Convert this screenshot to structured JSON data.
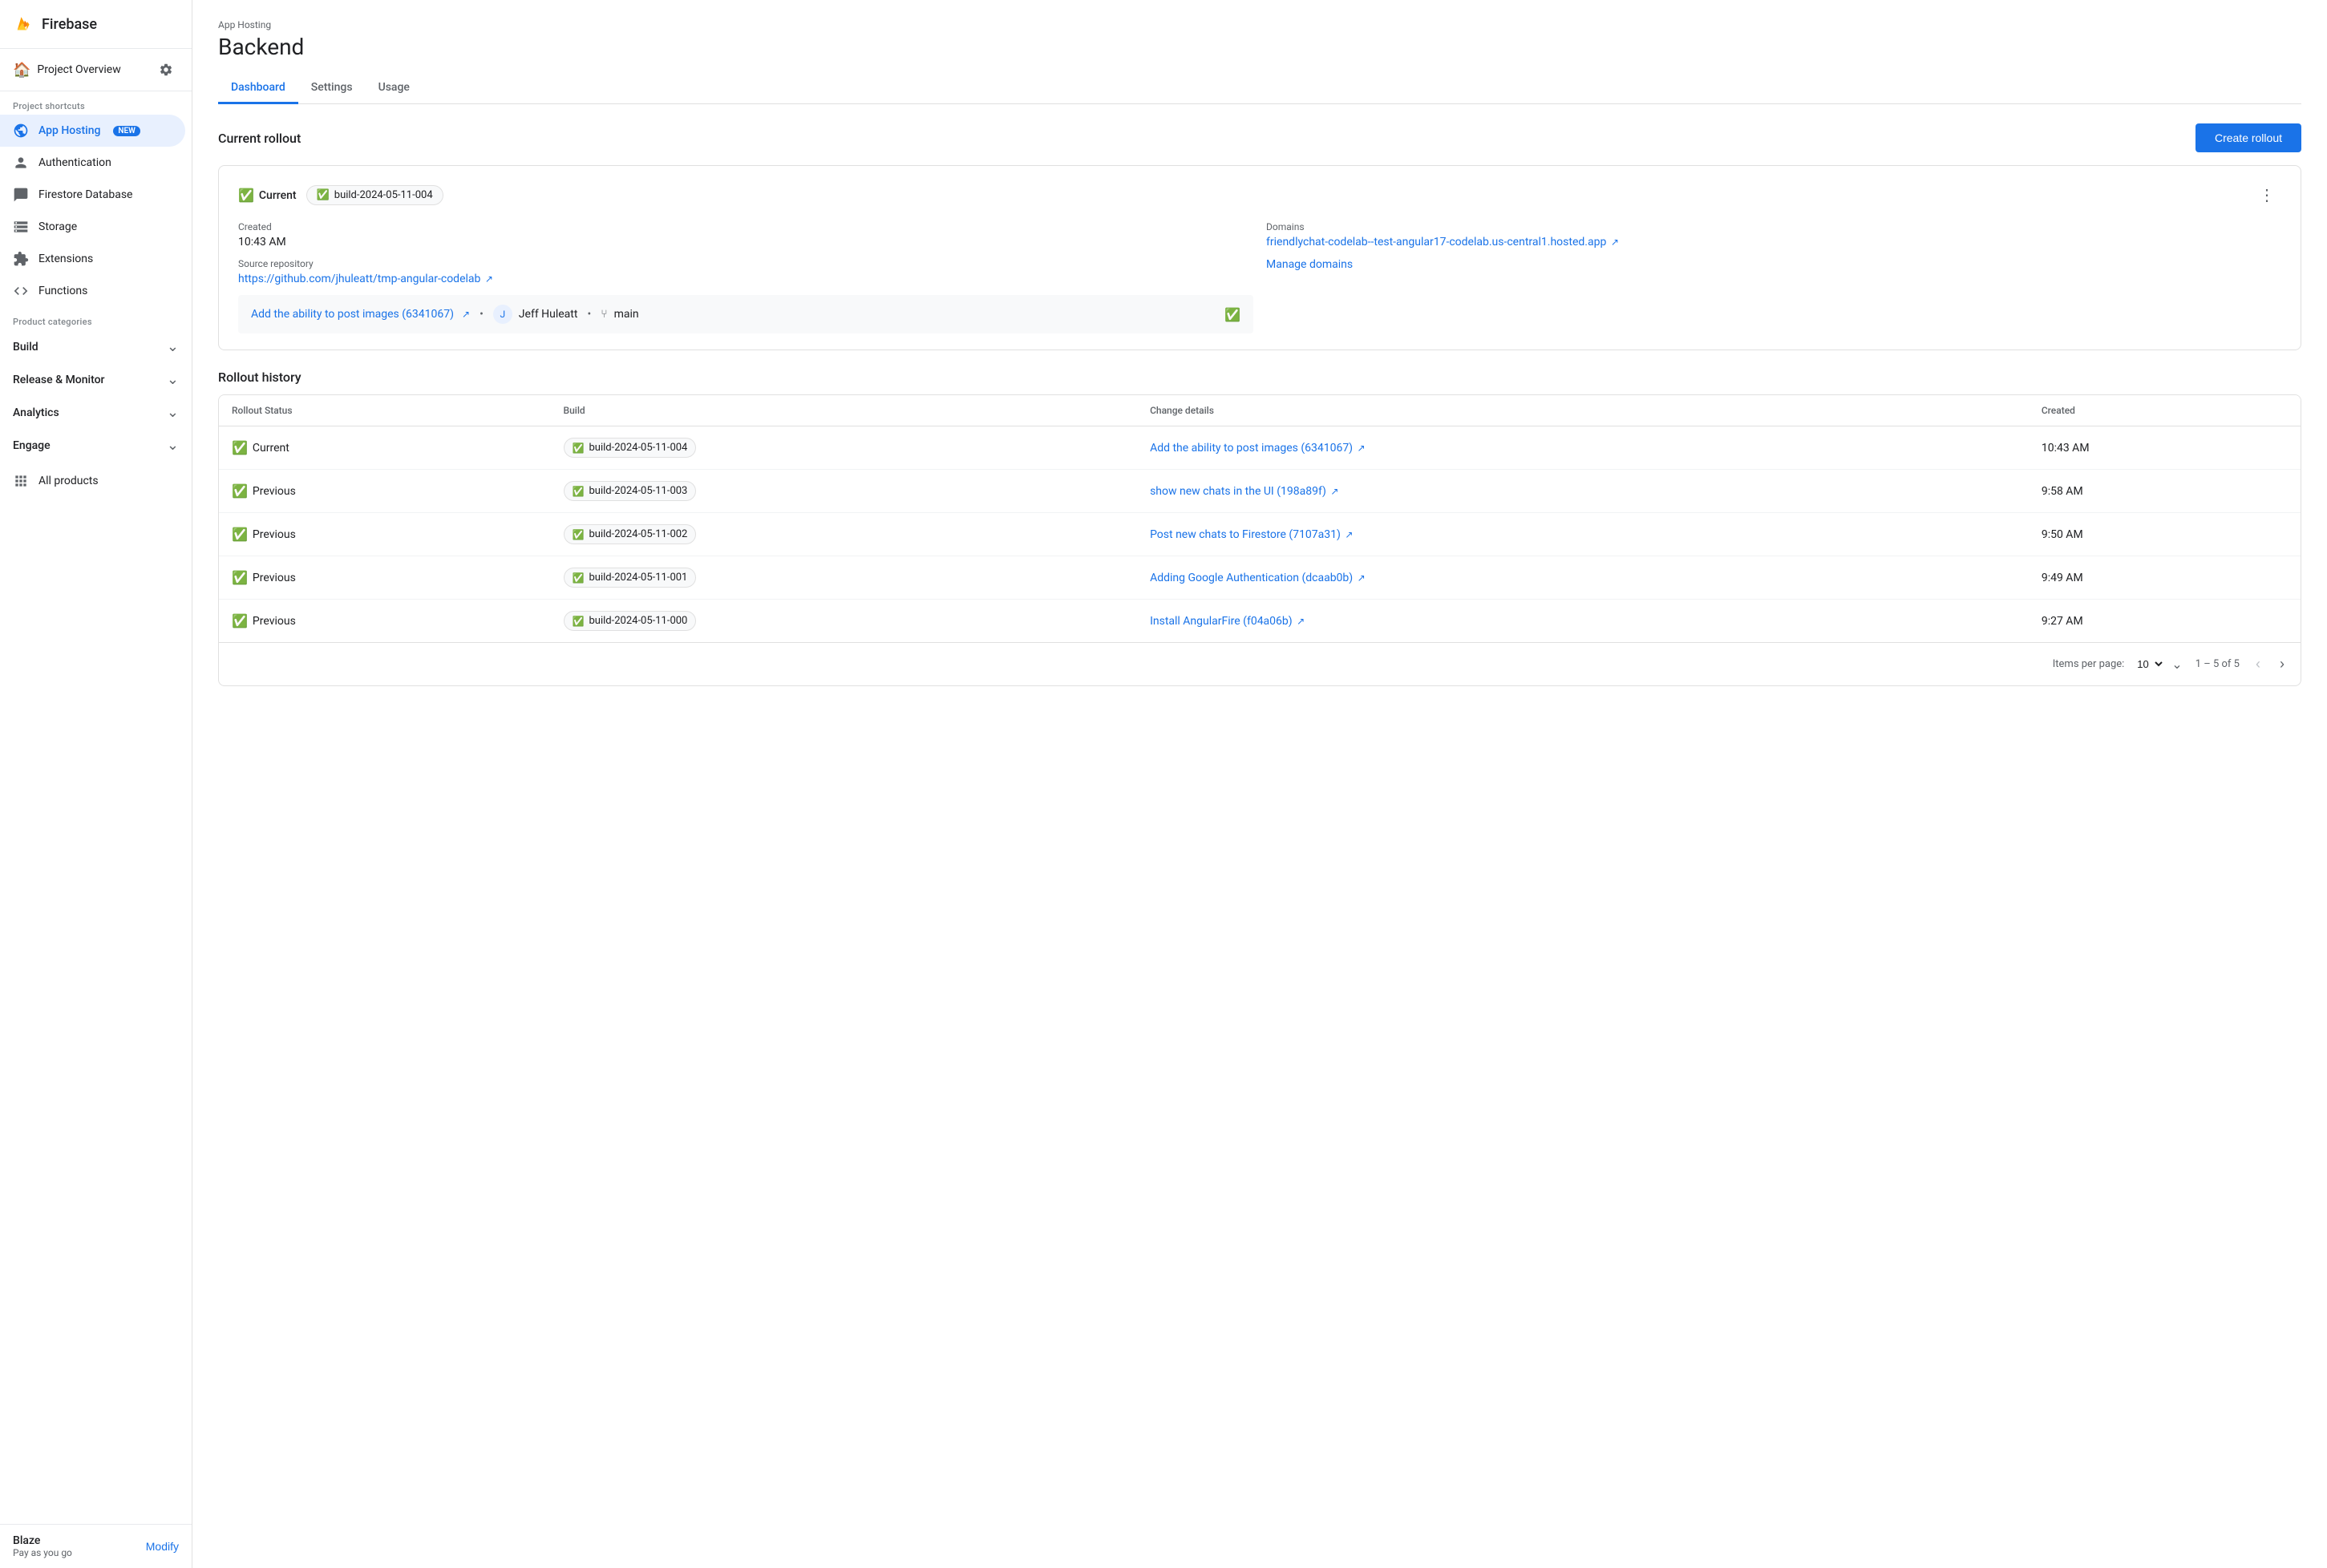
{
  "sidebar": {
    "app_title": "Firebase",
    "project_overview": "Project Overview",
    "project_shortcuts_label": "Project shortcuts",
    "nav_items": [
      {
        "id": "app-hosting",
        "label": "App Hosting",
        "badge": "NEW",
        "active": true
      },
      {
        "id": "authentication",
        "label": "Authentication"
      },
      {
        "id": "firestore",
        "label": "Firestore Database"
      },
      {
        "id": "storage",
        "label": "Storage"
      },
      {
        "id": "extensions",
        "label": "Extensions"
      },
      {
        "id": "functions",
        "label": "Functions"
      }
    ],
    "product_categories_label": "Product categories",
    "categories": [
      {
        "id": "build",
        "label": "Build"
      },
      {
        "id": "release-monitor",
        "label": "Release & Monitor"
      },
      {
        "id": "analytics",
        "label": "Analytics"
      },
      {
        "id": "engage",
        "label": "Engage"
      }
    ],
    "all_products": "All products",
    "plan_name": "Blaze",
    "plan_desc": "Pay as you go",
    "modify_label": "Modify"
  },
  "header": {
    "section": "App Hosting",
    "title": "Backend"
  },
  "tabs": [
    {
      "id": "dashboard",
      "label": "Dashboard",
      "active": true
    },
    {
      "id": "settings",
      "label": "Settings"
    },
    {
      "id": "usage",
      "label": "Usage"
    }
  ],
  "current_rollout": {
    "section_title": "Current rollout",
    "create_button": "Create rollout",
    "status": "Current",
    "build_id": "build-2024-05-11-004",
    "created_label": "Created",
    "created_time": "10:43 AM",
    "source_repo_label": "Source repository",
    "source_repo_url": "https://github.com/jhuleatt/tmp-angular-codelab",
    "domains_label": "Domains",
    "domain_url": "friendlychat-codelab--test-angular17-codelab.us-central1.hosted.app",
    "commit_title": "Add the ability to post images (6341067)",
    "author": "Jeff Huleatt",
    "branch": "main",
    "manage_domains": "Manage domains"
  },
  "rollout_history": {
    "section_title": "Rollout history",
    "columns": [
      "Rollout Status",
      "Build",
      "Change details",
      "Created"
    ],
    "rows": [
      {
        "status": "Current",
        "build": "build-2024-05-11-004",
        "change": "Add the ability to post images (6341067)",
        "created": "10:43 AM"
      },
      {
        "status": "Previous",
        "build": "build-2024-05-11-003",
        "change": "show new chats in the UI (198a89f)",
        "created": "9:58 AM"
      },
      {
        "status": "Previous",
        "build": "build-2024-05-11-002",
        "change": "Post new chats to Firestore (7107a31)",
        "created": "9:50 AM"
      },
      {
        "status": "Previous",
        "build": "build-2024-05-11-001",
        "change": "Adding Google Authentication (dcaab0b)",
        "created": "9:49 AM"
      },
      {
        "status": "Previous",
        "build": "build-2024-05-11-000",
        "change": "Install AngularFire (f04a06b)",
        "created": "9:27 AM"
      }
    ],
    "items_per_page_label": "Items per page:",
    "items_per_page_value": "10",
    "page_info": "1 – 5 of 5"
  },
  "colors": {
    "accent": "#1a73e8",
    "green": "#34a853",
    "sidebar_active_bg": "#e8f0fe"
  }
}
